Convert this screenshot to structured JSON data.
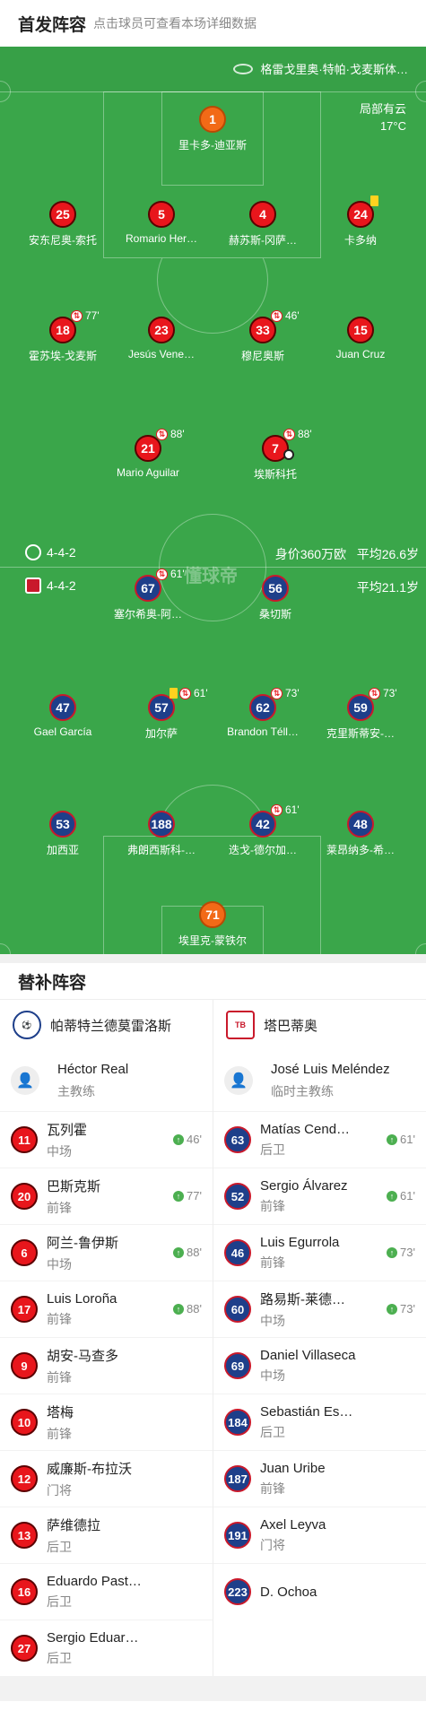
{
  "header": {
    "title": "首发阵容",
    "subtitle": "点击球员可查看本场详细数据"
  },
  "venue": "格雷戈里奥·特帕·戈麦斯体…",
  "weather": {
    "condition": "局部有云",
    "temp": "17°C"
  },
  "watermark": "懂球帝",
  "home": {
    "formation": "4-4-2",
    "value": "身价360万欧",
    "age": "平均26.6岁",
    "players": [
      {
        "num": "1",
        "name": "里卡多-迪亚斯",
        "gk": true
      },
      {
        "num": "25",
        "name": "安东尼奥-索托"
      },
      {
        "num": "5",
        "name": "Romario Her…"
      },
      {
        "num": "4",
        "name": "赫苏斯-冈萨…"
      },
      {
        "num": "24",
        "name": "卡多纳",
        "yellow": true
      },
      {
        "num": "18",
        "name": "霍苏埃-戈麦斯",
        "sub": "77'"
      },
      {
        "num": "23",
        "name": "Jesús Vene…"
      },
      {
        "num": "33",
        "name": "穆尼奥斯",
        "sub": "46'"
      },
      {
        "num": "15",
        "name": "Juan Cruz"
      },
      {
        "num": "21",
        "name": "Mario Aguilar",
        "sub": "88'"
      },
      {
        "num": "7",
        "name": "埃斯科托",
        "sub": "88'",
        "goal": true
      }
    ]
  },
  "away": {
    "formation": "4-4-2",
    "age": "平均21.1岁",
    "players": [
      {
        "num": "67",
        "name": "塞尔希奥-阿…",
        "sub": "61'"
      },
      {
        "num": "56",
        "name": "桑切斯"
      },
      {
        "num": "47",
        "name": "Gael García"
      },
      {
        "num": "57",
        "name": "加尔萨",
        "sub": "61'",
        "yellow": true
      },
      {
        "num": "62",
        "name": "Brandon Téll…",
        "sub": "73'"
      },
      {
        "num": "59",
        "name": "克里斯蒂安-…",
        "sub": "73'"
      },
      {
        "num": "53",
        "name": "加西亚"
      },
      {
        "num": "188",
        "name": "弗朗西斯科-…"
      },
      {
        "num": "42",
        "name": "迭戈-德尔加…",
        "sub": "61'"
      },
      {
        "num": "48",
        "name": "莱昂纳多-希…"
      },
      {
        "num": "71",
        "name": "埃里克-蒙铁尔",
        "gk": true
      }
    ]
  },
  "subs_title": "替补阵容",
  "home_bench": {
    "team": "帕蒂特兰德莫雷洛斯",
    "coach": {
      "name": "Héctor Real",
      "role": "主教练"
    },
    "players": [
      {
        "num": "11",
        "name": "瓦列霍",
        "pos": "中场",
        "in": "46'"
      },
      {
        "num": "20",
        "name": "巴斯克斯",
        "pos": "前锋",
        "in": "77'"
      },
      {
        "num": "6",
        "name": "阿兰-鲁伊斯",
        "pos": "中场",
        "in": "88'"
      },
      {
        "num": "17",
        "name": "Luis Loroña",
        "pos": "前锋",
        "in": "88'"
      },
      {
        "num": "9",
        "name": "胡安-马查多",
        "pos": "前锋"
      },
      {
        "num": "10",
        "name": "塔梅",
        "pos": "前锋"
      },
      {
        "num": "12",
        "name": "威廉斯-布拉沃",
        "pos": "门将"
      },
      {
        "num": "13",
        "name": "萨维德拉",
        "pos": "后卫"
      },
      {
        "num": "16",
        "name": "Eduardo Past…",
        "pos": "后卫"
      },
      {
        "num": "27",
        "name": "Sergio Eduar…",
        "pos": "后卫"
      }
    ]
  },
  "away_bench": {
    "team": "塔巴蒂奥",
    "coach": {
      "name": "José Luis Meléndez",
      "role": "临时主教练"
    },
    "players": [
      {
        "num": "63",
        "name": "Matías Cend…",
        "pos": "后卫",
        "in": "61'"
      },
      {
        "num": "52",
        "name": "Sergio Álvarez",
        "pos": "前锋",
        "in": "61'"
      },
      {
        "num": "46",
        "name": "Luis Egurrola",
        "pos": "前锋",
        "in": "73'"
      },
      {
        "num": "60",
        "name": "路易斯-莱德…",
        "pos": "中场",
        "in": "73'"
      },
      {
        "num": "69",
        "name": "Daniel Villaseca",
        "pos": "中场"
      },
      {
        "num": "184",
        "name": "Sebastián Es…",
        "pos": "后卫"
      },
      {
        "num": "187",
        "name": "Juan Uribe",
        "pos": "前锋"
      },
      {
        "num": "191",
        "name": "Axel Leyva",
        "pos": "门将"
      },
      {
        "num": "223",
        "name": "D. Ochoa",
        "pos": ""
      }
    ]
  }
}
